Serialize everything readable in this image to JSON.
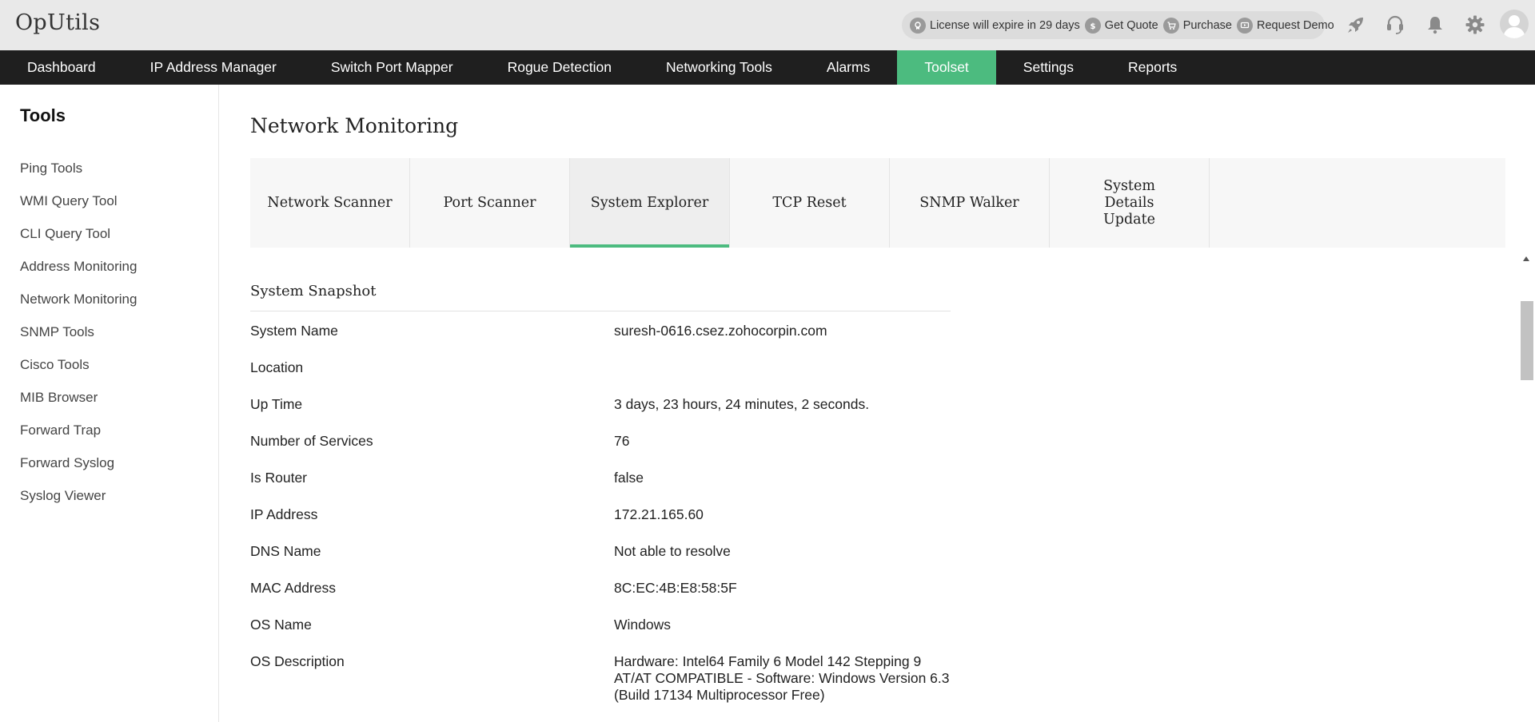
{
  "app": {
    "logo": "OpUtils"
  },
  "header": {
    "license_text": "License will expire in 29 days",
    "get_quote": "Get Quote",
    "purchase": "Purchase",
    "request_demo": "Request Demo",
    "icons": [
      "rocket-icon",
      "headset-icon",
      "bell-icon",
      "gear-icon",
      "user-avatar-icon"
    ]
  },
  "nav": {
    "items": [
      {
        "label": "Dashboard"
      },
      {
        "label": "IP Address Manager"
      },
      {
        "label": "Switch Port Mapper"
      },
      {
        "label": "Rogue Detection"
      },
      {
        "label": "Networking Tools"
      },
      {
        "label": "Alarms"
      },
      {
        "label": "Toolset"
      },
      {
        "label": "Settings"
      },
      {
        "label": "Reports"
      }
    ],
    "active": "Toolset",
    "active_color": "#4cbb7f"
  },
  "sidebar": {
    "title": "Tools",
    "items": [
      {
        "label": "Ping Tools"
      },
      {
        "label": "WMI Query Tool"
      },
      {
        "label": "CLI Query Tool"
      },
      {
        "label": "Address Monitoring"
      },
      {
        "label": "Network Monitoring"
      },
      {
        "label": "SNMP Tools"
      },
      {
        "label": "Cisco Tools"
      },
      {
        "label": "MIB Browser"
      },
      {
        "label": "Forward Trap"
      },
      {
        "label": "Forward Syslog"
      },
      {
        "label": "Syslog Viewer"
      }
    ]
  },
  "main": {
    "title": "Network Monitoring",
    "tabs": [
      {
        "label": "Network Scanner"
      },
      {
        "label": "Port Scanner"
      },
      {
        "label": "System Explorer"
      },
      {
        "label": "TCP Reset"
      },
      {
        "label": "SNMP Walker"
      },
      {
        "label": "System Details Update"
      }
    ],
    "active_tab": "System Explorer",
    "snapshot": {
      "title": "System Snapshot",
      "rows": [
        {
          "key": "System Name",
          "value": "suresh-0616.csez.zohocorpin.com"
        },
        {
          "key": "Location",
          "value": ""
        },
        {
          "key": "Up Time",
          "value": "3 days, 23 hours, 24 minutes, 2 seconds."
        },
        {
          "key": "Number of Services",
          "value": "76"
        },
        {
          "key": "Is Router",
          "value": "false"
        },
        {
          "key": "IP Address",
          "value": "172.21.165.60"
        },
        {
          "key": "DNS Name",
          "value": "Not able to resolve"
        },
        {
          "key": "MAC Address",
          "value": "8C:EC:4B:E8:58:5F"
        },
        {
          "key": "OS Name",
          "value": "Windows"
        },
        {
          "key": "OS Description",
          "value": "Hardware: Intel64 Family 6 Model 142 Stepping 9 AT/AT COMPATIBLE - Software: Windows Version 6.3 (Build 17134 Multiprocessor Free)"
        }
      ]
    }
  }
}
